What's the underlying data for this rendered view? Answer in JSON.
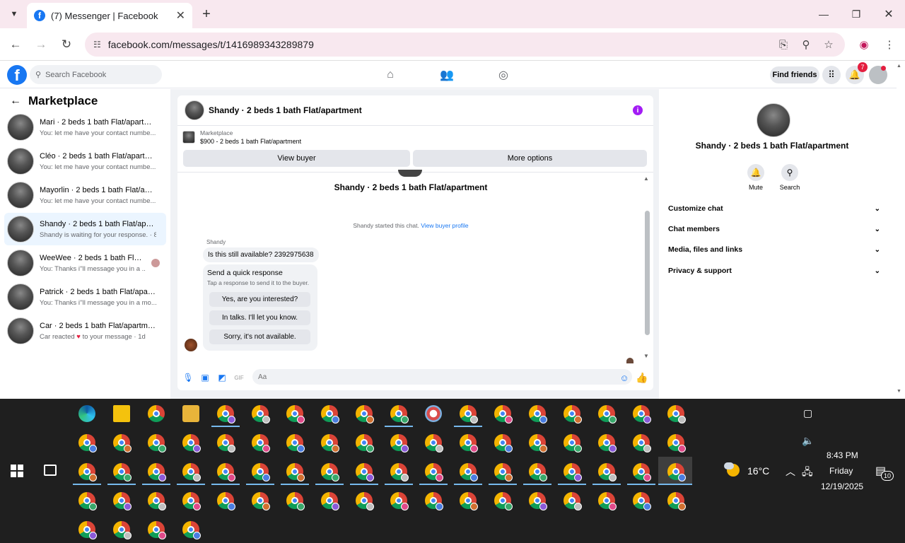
{
  "browser": {
    "tab_title": "(7) Messenger | Facebook",
    "url": "facebook.com/messages/t/1416989343289879"
  },
  "fb": {
    "search_placeholder": "Search Facebook",
    "find_friends": "Find friends",
    "notif_count": "7"
  },
  "marketplace": {
    "title": "Marketplace",
    "conversations": [
      {
        "name": "Mari · 2 beds 1 bath Flat/apartment",
        "preview": "You: let me have your contact numbe... · 1m"
      },
      {
        "name": "Cléo · 2 beds 1 bath Flat/apartment",
        "preview": "You: let me have your contact numbe... · 1m"
      },
      {
        "name": "Mayorlin · 2 beds 1 bath Flat/apart...",
        "preview": "You: let me have your contact numbe... · 1m"
      },
      {
        "name": "Shandy · 2 beds 1 bath Flat/apart...",
        "preview": "Shandy is waiting for your response. · 8h"
      },
      {
        "name": "WeeWee · 2 beds 1 bath Flat/ap...",
        "preview": "You: Thanks i''ll message you in a ... · 1d"
      },
      {
        "name": "Patrick · 2 beds 1 bath Flat/apartm...",
        "preview": "You: Thanks i''ll message you in a mo... · 1d"
      },
      {
        "name": "Car · 2 beds 1 bath Flat/apartment",
        "preview_before": "Car reacted",
        "preview_after": "to your message · 1d"
      }
    ]
  },
  "chat": {
    "header_name": "Shandy · 2 beds 1 bath Flat/apartment",
    "listing_label": "Marketplace",
    "listing_title": "$900 - 2 beds 1 bath Flat/apartment",
    "view_buyer": "View buyer",
    "more_options": "More options",
    "big_name": "Shandy · 2 beds 1 bath Flat/apartment",
    "started_text": "Shandy started this chat.",
    "view_profile": "View buyer profile",
    "sender": "Shandy",
    "message": "Is this still available? 2392975638",
    "quick_title": "Send a quick response",
    "quick_sub": "Tap a response to send it to the buyer.",
    "quick_replies": [
      "Yes, are you interested?",
      "In talks. I'll let you know.",
      "Sorry, it's not available."
    ],
    "input_placeholder": "Aa"
  },
  "details": {
    "name": "Shandy · 2 beds 1 bath Flat/apartment",
    "mute": "Mute",
    "search": "Search",
    "sections": [
      "Customize chat",
      "Chat members",
      "Media, files and links",
      "Privacy & support"
    ]
  },
  "taskbar": {
    "weather": "16°C",
    "time": "8:43 PM",
    "day": "Friday",
    "date": "12/19/2025",
    "notifications": "10"
  },
  "colors": {
    "fb_blue": "#1877f2",
    "info_purple": "#a31cf5",
    "taskbar_bg": "#1f1f1f"
  }
}
